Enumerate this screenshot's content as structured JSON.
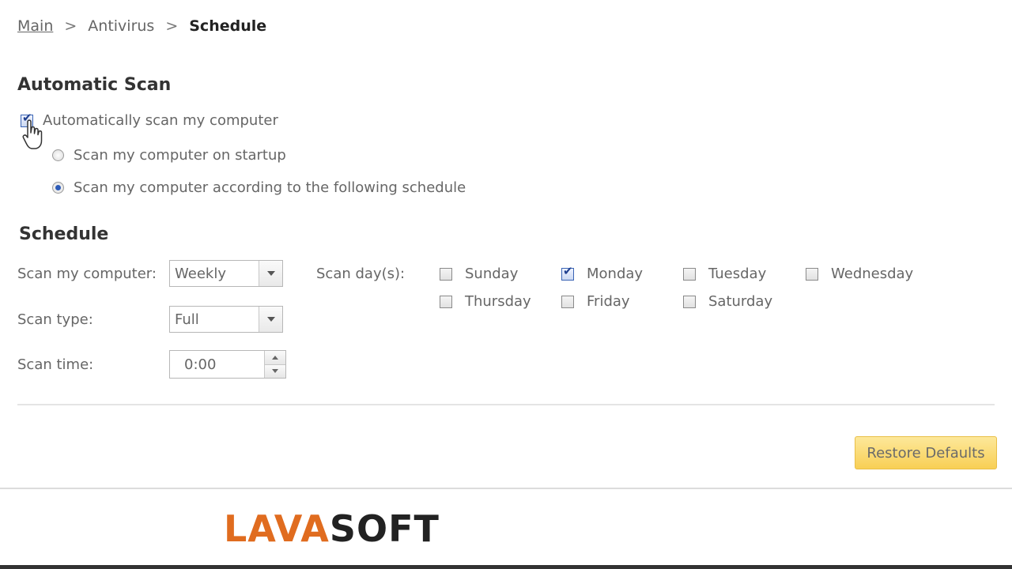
{
  "breadcrumb": {
    "items": [
      "Main",
      "Antivirus",
      "Schedule"
    ],
    "separator": ">"
  },
  "automatic_scan": {
    "title": "Automatic Scan",
    "auto_scan_label": "Automatically scan my computer",
    "auto_scan_checked": true,
    "options": [
      {
        "label": "Scan my computer on startup",
        "selected": false
      },
      {
        "label": "Scan my computer according to the following schedule",
        "selected": true
      }
    ]
  },
  "schedule": {
    "title": "Schedule",
    "frequency_label": "Scan my computer:",
    "frequency_value": "Weekly",
    "type_label": "Scan type:",
    "type_value": "Full",
    "time_label": "Scan time:",
    "time_value": "0:00",
    "days_label": "Scan day(s):",
    "days": [
      {
        "label": "Sunday",
        "checked": false
      },
      {
        "label": "Monday",
        "checked": true
      },
      {
        "label": "Tuesday",
        "checked": false
      },
      {
        "label": "Wednesday",
        "checked": false
      },
      {
        "label": "Thursday",
        "checked": false
      },
      {
        "label": "Friday",
        "checked": false
      },
      {
        "label": "Saturday",
        "checked": false
      }
    ]
  },
  "buttons": {
    "restore_defaults": "Restore Defaults"
  },
  "footer": {
    "logo_text": "LAVASOFT",
    "logo_part_1": "LAVA",
    "logo_part_2": "SOFT"
  },
  "colors": {
    "button_bg": "#f8cf55",
    "logo_orange": "#e06c1f",
    "logo_dark": "#222222",
    "check_accent": "#2d5bb8"
  }
}
